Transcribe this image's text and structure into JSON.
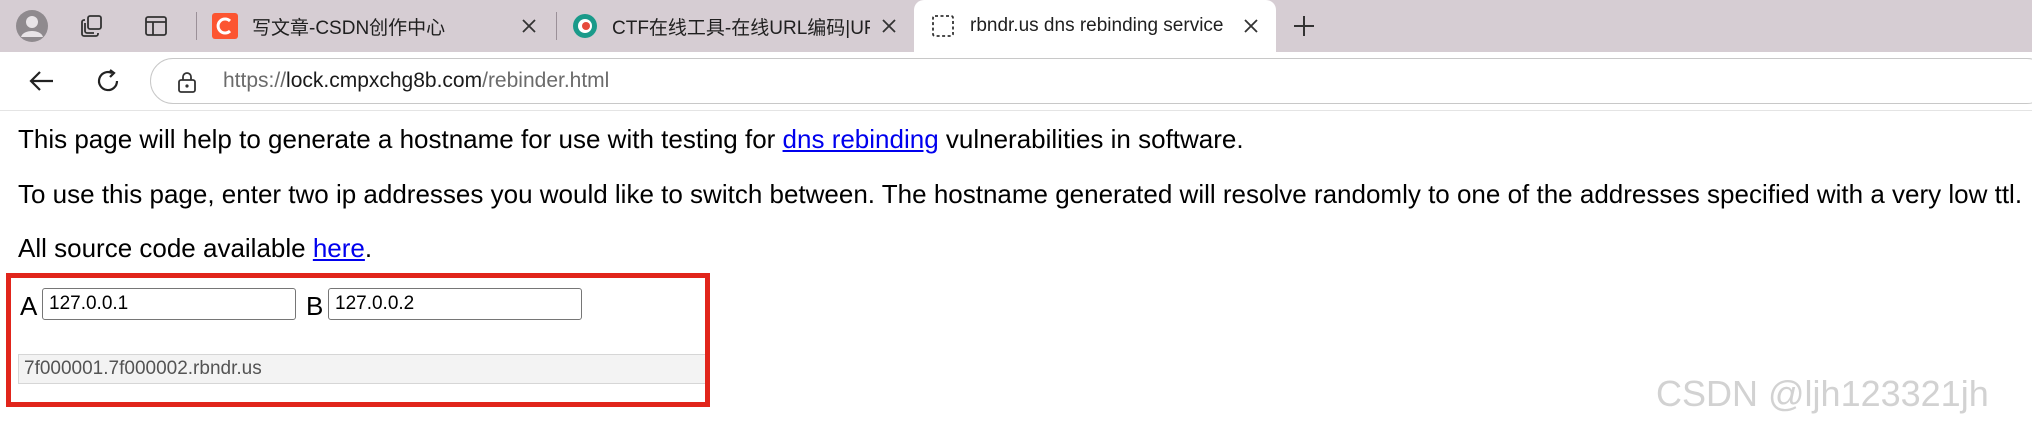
{
  "browser": {
    "tabs": [
      {
        "title": "写文章-CSDN创作中心",
        "favicon": "csdn-c-icon",
        "active": false
      },
      {
        "title": "CTF在线工具-在线URL编码|URL解",
        "favicon": "ctftools-icon",
        "active": false
      },
      {
        "title": "rbndr.us dns rebinding service",
        "favicon": "dashed-page-icon",
        "active": true
      }
    ],
    "url": {
      "scheme": "https://",
      "host": "lock.cmpxchg8b.com",
      "path": "/rebinder.html"
    },
    "accent_color": "#e1251b"
  },
  "page": {
    "para1_before": "This page will help to generate a hostname for use with testing for ",
    "para1_link": "dns rebinding",
    "para1_after": " vulnerabilities in software.",
    "para2": "To use this page, enter two ip addresses you would like to switch between. The hostname generated will resolve randomly to one of the addresses specified with a very low ttl.",
    "para3_before": "All source code available ",
    "para3_link": "here",
    "para3_after": ".",
    "label_a": "A",
    "value_a": "127.0.0.1",
    "label_b": "B",
    "value_b": "127.0.0.2",
    "result": "7f000001.7f000002.rbndr.us"
  },
  "watermark": "CSDN @ljh123321jh"
}
